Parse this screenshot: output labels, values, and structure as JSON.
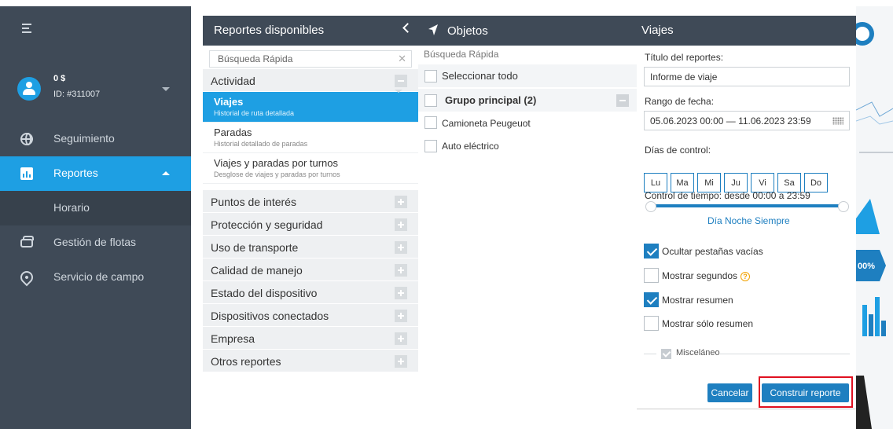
{
  "sidebar": {
    "user": {
      "balance": "0 $",
      "id": "ID: #311007"
    },
    "items": [
      {
        "label": "Seguimiento",
        "icon": "globe-icon"
      },
      {
        "label": "Reportes",
        "icon": "reports-icon"
      },
      {
        "label": "Horario",
        "icon": ""
      },
      {
        "label": "Gestión de flotas",
        "icon": "car-icon"
      },
      {
        "label": "Servicio de campo",
        "icon": "location-pin-icon"
      }
    ]
  },
  "header": {
    "reports": "Reportes disponibles",
    "objects": "Objetos",
    "trip": "Viajes"
  },
  "reports": {
    "search_placeholder": "Búsqueda Rápida",
    "groups": [
      "Actividad",
      "Puntos de interés",
      "Protección y seguridad",
      "Uso de transporte",
      "Calidad de manejo",
      "Estado del dispositivo",
      "Dispositivos conectados",
      "Empresa",
      "Otros reportes"
    ],
    "items": [
      {
        "title": "Viajes",
        "subtitle": "Historial de ruta detallada"
      },
      {
        "title": "Paradas",
        "subtitle": "Historial detallado de paradas"
      },
      {
        "title": "Viajes y paradas por turnos",
        "subtitle": "Desglose de viajes y paradas por turnos"
      }
    ]
  },
  "objects": {
    "search_placeholder": "Búsqueda Rápida",
    "select_all": "Seleccionar todo",
    "group": "Grupo principal (2)",
    "list": [
      "Camioneta Peugeuot",
      "Auto eléctrico"
    ]
  },
  "form": {
    "title_label": "Título del reportes:",
    "title_value": "Informe de viaje",
    "date_label": "Rango de fecha:",
    "date_value": "05.06.2023 00:00 — 11.06.2023 23:59",
    "days_label": "Días de control:",
    "days": [
      "Lu",
      "Ma",
      "Mi",
      "Ju",
      "Vi",
      "Sa",
      "Do"
    ],
    "time_label": "Control de tiempo: desde 00:00 a 23:59",
    "quick": [
      "Día",
      "Noche",
      "Siempre"
    ],
    "options": [
      {
        "label": "Ocultar pestañas vacías",
        "checked": true
      },
      {
        "label": "Mostrar segundos",
        "checked": false
      },
      {
        "label": "Mostrar resumen",
        "checked": true
      },
      {
        "label": "Mostrar sólo resumen",
        "checked": false
      }
    ],
    "misc": "Misceláneo",
    "cancel": "Cancelar",
    "build": "Construir reporte"
  },
  "background": {
    "percent": "00%"
  },
  "colors": {
    "sidebar": "#3f4a57",
    "accent": "#1e9fe3",
    "button": "#1e7fc0",
    "highlight": "#e01020"
  }
}
